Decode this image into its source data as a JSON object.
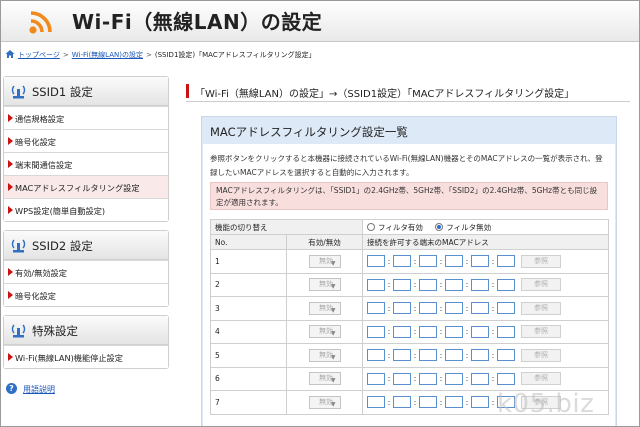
{
  "header": {
    "title": "Wi-Fi（無線LAN）の設定"
  },
  "breadcrumb": {
    "items": [
      "トップページ",
      "Wi-Fi(無線LAN)の設定",
      "(SSID1設定)「MACアドレスフィルタリング設定」"
    ],
    "separator": ">"
  },
  "sidebar": {
    "groups": [
      {
        "title": "SSID1 設定",
        "items": [
          "通信規格設定",
          "暗号化設定",
          "端末間通信設定",
          "MACアドレスフィルタリング設定",
          "WPS設定(簡単自動設定)"
        ]
      },
      {
        "title": "SSID2 設定",
        "items": [
          "有効/無効設定",
          "暗号化設定"
        ]
      },
      {
        "title": "特殊設定",
        "items": [
          "Wi-Fi(無線LAN)機能停止設定"
        ]
      }
    ],
    "help_label": "用語説明"
  },
  "main": {
    "page_title": "「Wi-Fi（無線LAN）の設定」→（SSID1設定）「MACアドレスフィルタリング設定」",
    "panel_title": "MACアドレスフィルタリング設定一覧",
    "description": "参照ボタンをクリックすると本機器に接続されているWi-Fi(無線LAN)機器とそのMACアドレスの一覧が表示され、登録したいMACアドレスを選択すると自動的に入力されます。",
    "note": "MACアドレスフィルタリングは、「SSID1」の2.4GHz帯、5GHz帯、「SSID2」の2.4GHz帯、5GHz帯とも同じ設定が適用されます。",
    "filter_toggle_label": "機能の切り替え",
    "filter_on_label": "フィルタ有効",
    "filter_off_label": "フィルタ無効",
    "col_no": "No.",
    "col_enabled": "有効/無効",
    "col_mac": "接続を許可する端末のMACアドレス",
    "row_select_value": "無効",
    "ref_button_label": "参照",
    "rows": [
      "1",
      "2",
      "3",
      "4",
      "5",
      "6",
      "7"
    ]
  },
  "watermark": "k05.biz",
  "colors": {
    "accent_red": "#cc1111",
    "panel_blue": "#dde9f7",
    "link_blue": "#1a55b8",
    "wifi_orange": "#f08a1c"
  }
}
